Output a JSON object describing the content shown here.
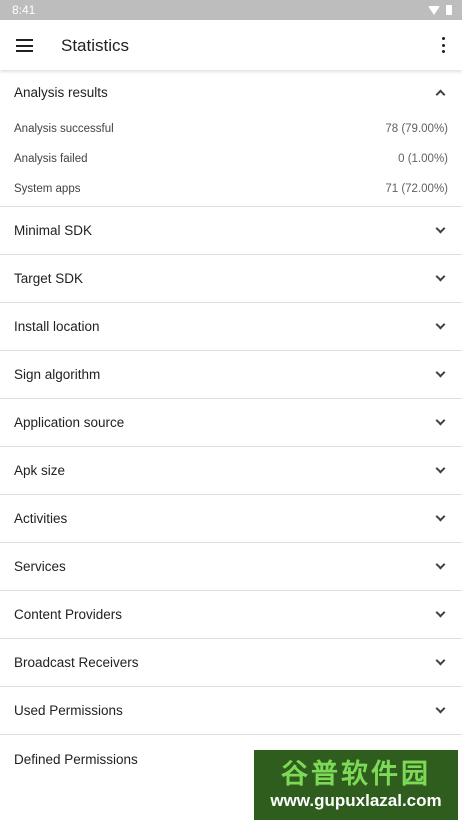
{
  "status_bar": {
    "time": "8:41",
    "wifi_icon": "wifi-icon",
    "battery_icon": "battery-icon"
  },
  "toolbar": {
    "title": "Statistics",
    "menu_icon": "hamburger-menu-icon",
    "overflow_icon": "more-vert-icon"
  },
  "analysis": {
    "title": "Analysis results",
    "expanded": true,
    "rows": [
      {
        "label": "Analysis successful",
        "value": "78  (79.00%)"
      },
      {
        "label": "Analysis failed",
        "value": "0  (1.00%)"
      },
      {
        "label": "System apps",
        "value": "71  (72.00%)"
      }
    ]
  },
  "groups": [
    "Minimal SDK",
    "Target SDK",
    "Install location",
    "Sign algorithm",
    "Application source",
    "Apk size",
    "Activities",
    "Services",
    "Content Providers",
    "Broadcast Receivers",
    "Used Permissions",
    "Defined Permissions"
  ],
  "watermark": {
    "line1": "谷普软件园",
    "line2": "www.gupuxlazal.com"
  }
}
